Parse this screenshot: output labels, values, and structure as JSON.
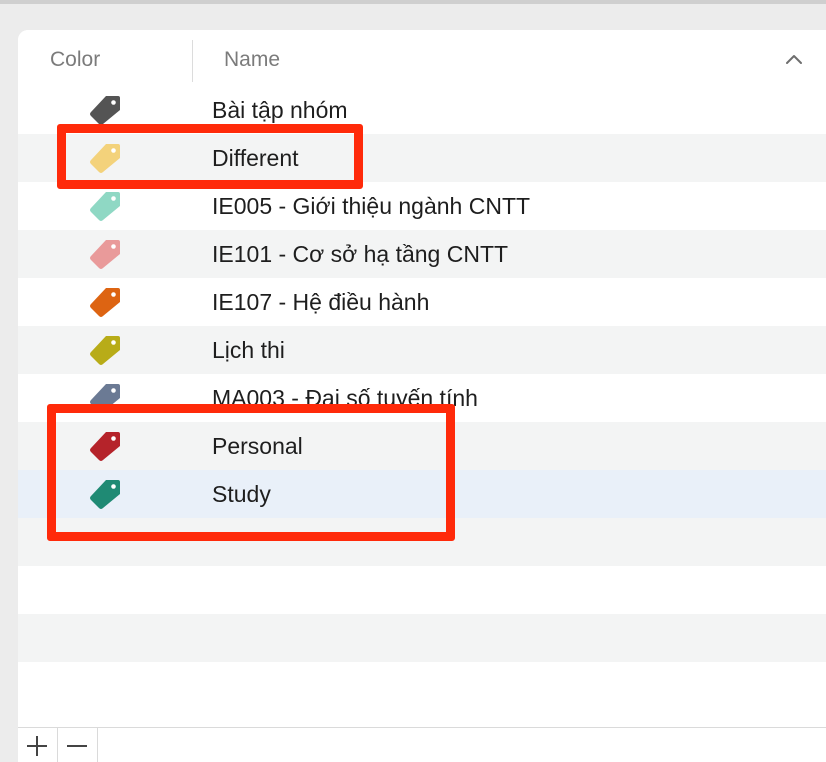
{
  "header": {
    "color_label": "Color",
    "name_label": "Name",
    "sort_icon": "chevron-up-icon"
  },
  "tags": [
    {
      "name": "Bài tập nhóm",
      "color": "#545454"
    },
    {
      "name": "Different",
      "color": "#f3d27b"
    },
    {
      "name": "IE005 - Giới thiệu ngành CNTT",
      "color": "#8fd8c4"
    },
    {
      "name": "IE101 - Cơ sở hạ tầng CNTT",
      "color": "#e99a9a"
    },
    {
      "name": "IE107 - Hệ điều hành",
      "color": "#dd6412"
    },
    {
      "name": "Lịch thi",
      "color": "#b8ac18"
    },
    {
      "name": "MA003 - Đại số tuyến tính",
      "color": "#6b7a94"
    },
    {
      "name": "Personal",
      "color": "#b5232a"
    },
    {
      "name": "Study",
      "color": "#1f8a74"
    }
  ],
  "selected_tag": "Study",
  "toolbar": {
    "add_icon": "plus-icon",
    "remove_icon": "minus-icon"
  },
  "highlight_color": "#ff2a0a"
}
